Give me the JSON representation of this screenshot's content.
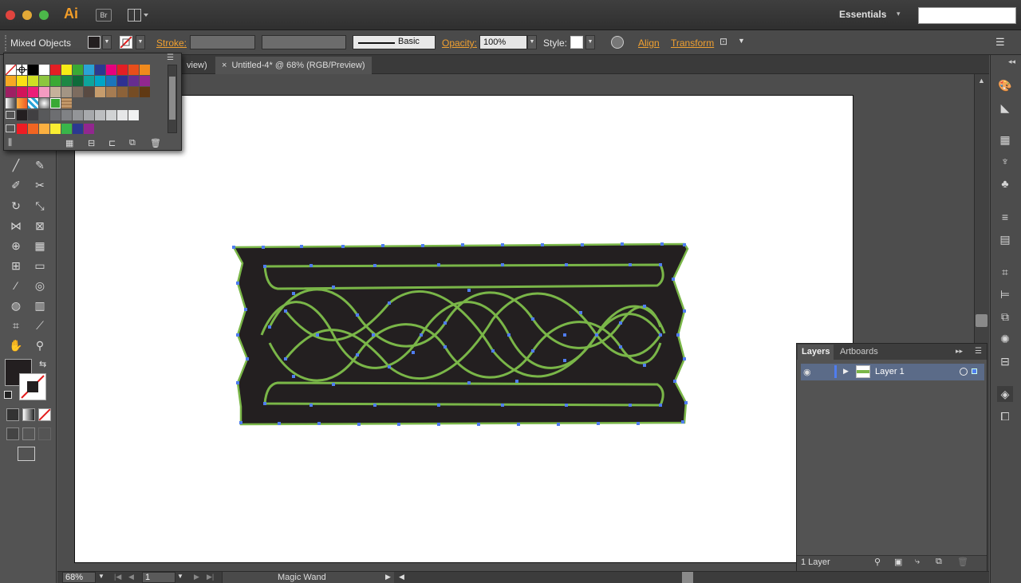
{
  "app": {
    "logo": "Ai",
    "bridge": "Br",
    "workspace": "Essentials"
  },
  "control_bar": {
    "selection_label": "Mixed Objects",
    "stroke_label": "Stroke:",
    "brush_label": "Basic",
    "opacity_label": "Opacity:",
    "opacity_value": "100%",
    "style_label": "Style:",
    "align_label": "Align",
    "transform_label": "Transform"
  },
  "tabs": [
    {
      "label": "view)"
    },
    {
      "label": "Untitled-4* @ 68% (RGB/Preview)"
    }
  ],
  "status_bar": {
    "zoom": "68%",
    "page": "1",
    "tool": "Magic Wand"
  },
  "layers_panel": {
    "tab_layers": "Layers",
    "tab_artboards": "Artboards",
    "layer_name": "Layer 1",
    "footer": "1 Layer"
  },
  "swatches": {
    "row1": [
      "#ffffff",
      "#ffffff",
      "#000000",
      "#ffffff",
      "#e31e24",
      "#f6eb16",
      "#39a935",
      "#2aa3d6",
      "#2b3990",
      "#e6007e",
      "#e31e24",
      "#e84e1b",
      "#f08a1d"
    ],
    "row2": [
      "#f7a823",
      "#fbe013",
      "#cfde24",
      "#8dc63f",
      "#39a935",
      "#1c8744",
      "#0e6b3a",
      "#0ea49b",
      "#00a5c6",
      "#1b75bb",
      "#2e3192",
      "#662d91",
      "#92278f"
    ],
    "row3": [
      "#9e1f63",
      "#d2145a",
      "#ed1e79",
      "#f49ac1",
      "#c6b19b",
      "#a39584",
      "#7d6c5f",
      "#594a42",
      "#c69c6d",
      "#a67c52",
      "#8c6239",
      "#754c24",
      "#603913"
    ],
    "gray_row": [
      "#231f20",
      "#414042",
      "#58595b",
      "#6d6e71",
      "#808285",
      "#939598",
      "#a7a9ac",
      "#bcbec0",
      "#d1d3d4",
      "#e6e7e8",
      "#f1f2f2"
    ],
    "bright_row": [
      "#ed1c24",
      "#f26522",
      "#fbb040",
      "#f9ed32",
      "#39b54a",
      "#2b3990",
      "#92278f"
    ]
  },
  "colors": {
    "accent_orange": "#f29d28",
    "link_orange": "#f0a030",
    "selection_green": "#6aa84f",
    "anchor_blue": "#4f7df0",
    "knot_fill": "#231f20"
  }
}
